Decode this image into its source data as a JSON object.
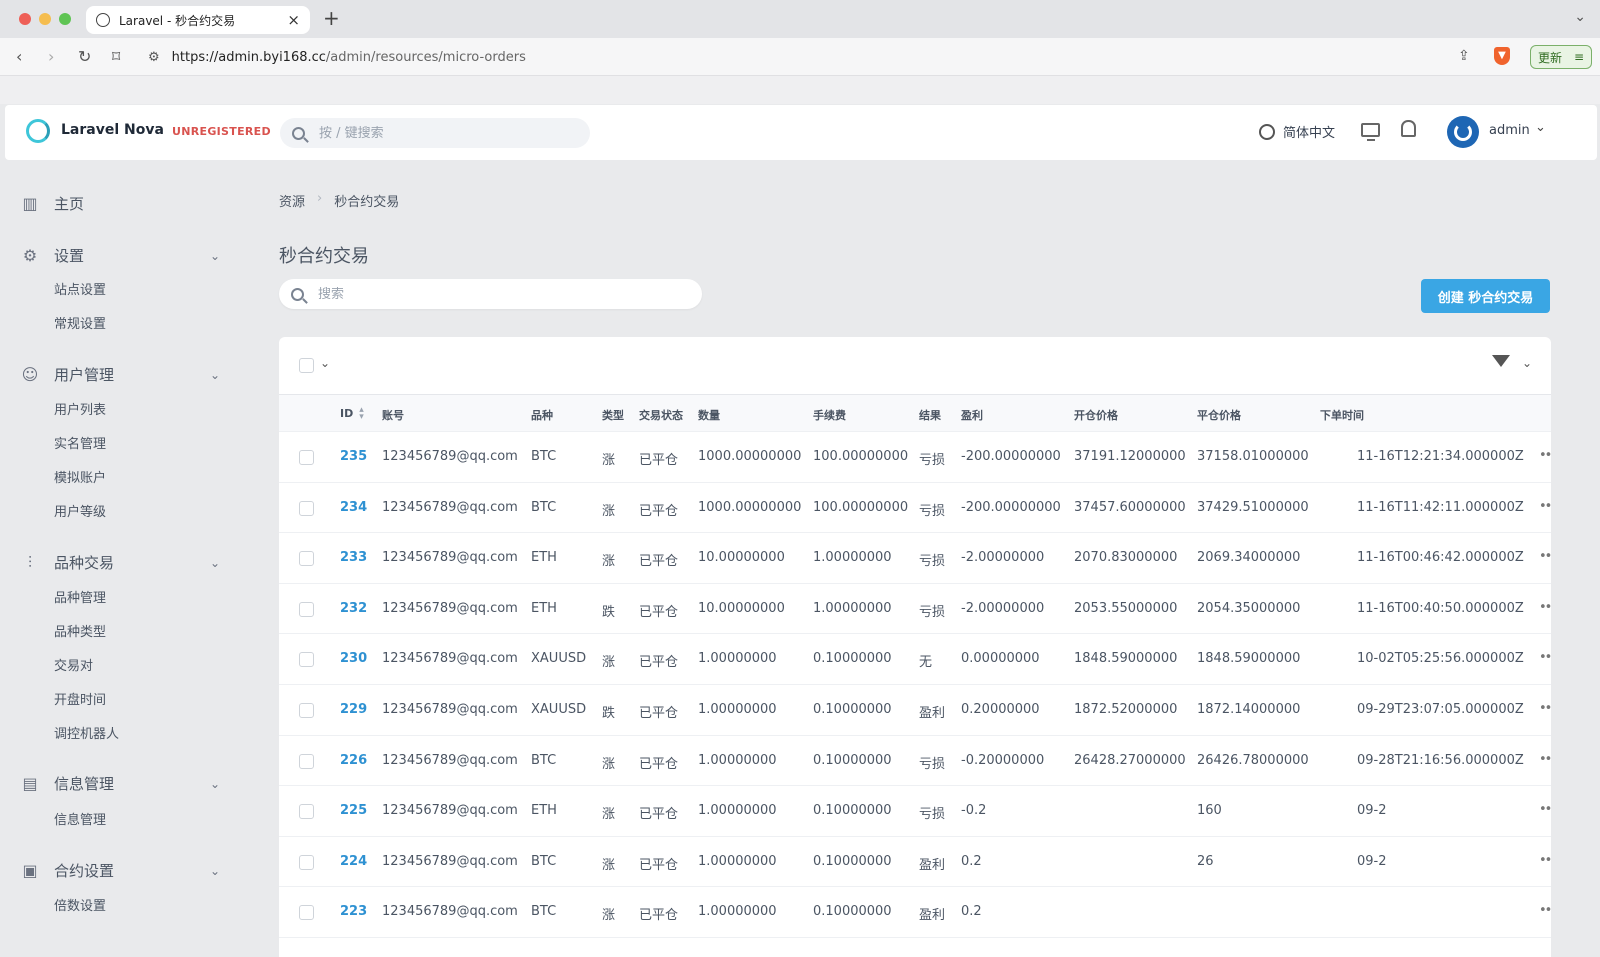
{
  "browser": {
    "tab_title": "Laravel - 秒合约交易",
    "url_host": "https://admin.byi168.cc",
    "url_path": "/admin/resources/micro-orders",
    "update_label": "更新"
  },
  "header": {
    "brand": "Laravel Nova",
    "badge": "UNREGISTERED",
    "search_placeholder": "按 / 键搜索",
    "language": "简体中文",
    "user": "admin"
  },
  "sidebar": {
    "groups": [
      {
        "label": "主页",
        "icon": "bar-chart-icon",
        "items": []
      },
      {
        "label": "设置",
        "icon": "gear-icon",
        "items": [
          "站点设置",
          "常规设置"
        ]
      },
      {
        "label": "用户管理",
        "icon": "users-icon",
        "items": [
          "用户列表",
          "实名管理",
          "模拟账户",
          "用户等级"
        ]
      },
      {
        "label": "品种交易",
        "icon": "sliders-icon",
        "items": [
          "品种管理",
          "品种类型",
          "交易对",
          "开盘时间",
          "调控机器人"
        ]
      },
      {
        "label": "信息管理",
        "icon": "message-icon",
        "items": [
          "信息管理"
        ]
      },
      {
        "label": "合约设置",
        "icon": "presentation-icon",
        "items": [
          "倍数设置"
        ]
      }
    ]
  },
  "main": {
    "breadcrumb": [
      "资源",
      "秒合约交易"
    ],
    "title": "秒合约交易",
    "search_placeholder": "搜索",
    "create_label": "创建 秒合约交易"
  },
  "table": {
    "columns": [
      "ID",
      "账号",
      "品种",
      "类型",
      "交易状态",
      "数量",
      "手续费",
      "结果",
      "盈利",
      "开仓价格",
      "平仓价格",
      "下单时间"
    ],
    "rows": [
      {
        "id": "235",
        "account": "123456789@qq.com",
        "symbol": "BTC",
        "type": "涨",
        "status": "已平仓",
        "qty": "1000.00000000",
        "fee": "100.00000000",
        "result": "亏损",
        "profit": "-200.00000000",
        "open": "37191.12000000",
        "close": "37158.01000000",
        "time": "11-16T12:21:34.000000Z"
      },
      {
        "id": "234",
        "account": "123456789@qq.com",
        "symbol": "BTC",
        "type": "涨",
        "status": "已平仓",
        "qty": "1000.00000000",
        "fee": "100.00000000",
        "result": "亏损",
        "profit": "-200.00000000",
        "open": "37457.60000000",
        "close": "37429.51000000",
        "time": "11-16T11:42:11.000000Z"
      },
      {
        "id": "233",
        "account": "123456789@qq.com",
        "symbol": "ETH",
        "type": "涨",
        "status": "已平仓",
        "qty": "10.00000000",
        "fee": "1.00000000",
        "result": "亏损",
        "profit": "-2.00000000",
        "open": "2070.83000000",
        "close": "2069.34000000",
        "time": "11-16T00:46:42.000000Z"
      },
      {
        "id": "232",
        "account": "123456789@qq.com",
        "symbol": "ETH",
        "type": "跌",
        "status": "已平仓",
        "qty": "10.00000000",
        "fee": "1.00000000",
        "result": "亏损",
        "profit": "-2.00000000",
        "open": "2053.55000000",
        "close": "2054.35000000",
        "time": "11-16T00:40:50.000000Z"
      },
      {
        "id": "230",
        "account": "123456789@qq.com",
        "symbol": "XAUUSD",
        "type": "涨",
        "status": "已平仓",
        "qty": "1.00000000",
        "fee": "0.10000000",
        "result": "无",
        "profit": "0.00000000",
        "open": "1848.59000000",
        "close": "1848.59000000",
        "time": "10-02T05:25:56.000000Z"
      },
      {
        "id": "229",
        "account": "123456789@qq.com",
        "symbol": "XAUUSD",
        "type": "跌",
        "status": "已平仓",
        "qty": "1.00000000",
        "fee": "0.10000000",
        "result": "盈利",
        "profit": "0.20000000",
        "open": "1872.52000000",
        "close": "1872.14000000",
        "time": "09-29T23:07:05.000000Z"
      },
      {
        "id": "226",
        "account": "123456789@qq.com",
        "symbol": "BTC",
        "type": "涨",
        "status": "已平仓",
        "qty": "1.00000000",
        "fee": "0.10000000",
        "result": "亏损",
        "profit": "-0.20000000",
        "open": "26428.27000000",
        "close": "26426.78000000",
        "time": "09-28T21:16:56.000000Z"
      },
      {
        "id": "225",
        "account": "123456789@qq.com",
        "symbol": "ETH",
        "type": "涨",
        "status": "已平仓",
        "qty": "1.00000000",
        "fee": "0.10000000",
        "result": "亏损",
        "profit": "-0.2",
        "open": "",
        "close": "160",
        "time": "09-2"
      },
      {
        "id": "224",
        "account": "123456789@qq.com",
        "symbol": "BTC",
        "type": "涨",
        "status": "已平仓",
        "qty": "1.00000000",
        "fee": "0.10000000",
        "result": "盈利",
        "profit": "0.2",
        "open": "",
        "close": "26",
        "time": "09-2"
      },
      {
        "id": "223",
        "account": "123456789@qq.com",
        "symbol": "BTC",
        "type": "涨",
        "status": "已平仓",
        "qty": "1.00000000",
        "fee": "0.10000000",
        "result": "盈利",
        "profit": "0.2",
        "open": "",
        "close": "",
        "time": ""
      }
    ]
  }
}
